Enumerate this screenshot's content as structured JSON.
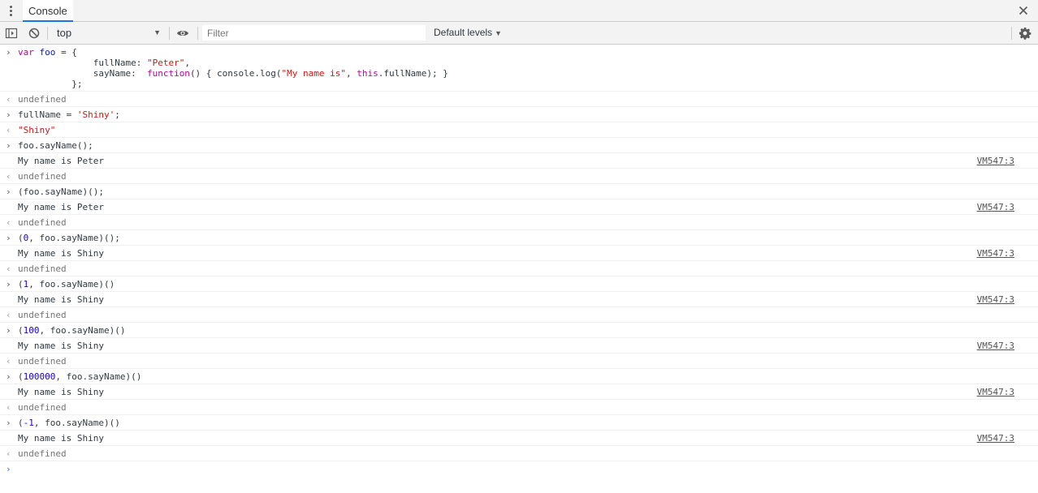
{
  "tabbar": {
    "tab_label": "Console"
  },
  "toolbar": {
    "context_value": "top",
    "filter_placeholder": "Filter",
    "levels_label": "Default levels"
  },
  "console": {
    "messages": [
      {
        "type": "input",
        "code": [
          {
            "t": "var ",
            "c": "kw"
          },
          {
            "t": "foo",
            "c": "var"
          },
          {
            "t": " = {\n              fullName: "
          },
          {
            "t": "\"Peter\"",
            "c": "str"
          },
          {
            "t": ",\n              sayName:  "
          },
          {
            "t": "function",
            "c": "kw"
          },
          {
            "t": "() { console.log("
          },
          {
            "t": "\"My name is\"",
            "c": "str"
          },
          {
            "t": ", "
          },
          {
            "t": "this",
            "c": "kw"
          },
          {
            "t": ".fullName); }\n          };"
          }
        ]
      },
      {
        "type": "result",
        "code": [
          {
            "t": "undefined"
          }
        ]
      },
      {
        "type": "input",
        "code": [
          {
            "t": "fullName = "
          },
          {
            "t": "'Shiny'",
            "c": "str"
          },
          {
            "t": ";"
          }
        ]
      },
      {
        "type": "result",
        "code": [
          {
            "t": "\"Shiny\"",
            "c": "str"
          }
        ]
      },
      {
        "type": "input",
        "code": [
          {
            "t": "foo.sayName();"
          }
        ]
      },
      {
        "type": "log",
        "code": [
          {
            "t": "My name is Peter"
          }
        ],
        "source": "VM547:3"
      },
      {
        "type": "result",
        "code": [
          {
            "t": "undefined"
          }
        ]
      },
      {
        "type": "input",
        "code": [
          {
            "t": "(foo.sayName)();"
          }
        ]
      },
      {
        "type": "log",
        "code": [
          {
            "t": "My name is Peter"
          }
        ],
        "source": "VM547:3"
      },
      {
        "type": "result",
        "code": [
          {
            "t": "undefined"
          }
        ]
      },
      {
        "type": "input",
        "code": [
          {
            "t": "("
          },
          {
            "t": "0",
            "c": "num"
          },
          {
            "t": ", foo.sayName)();"
          }
        ]
      },
      {
        "type": "log",
        "code": [
          {
            "t": "My name is Shiny"
          }
        ],
        "source": "VM547:3"
      },
      {
        "type": "result",
        "code": [
          {
            "t": "undefined"
          }
        ]
      },
      {
        "type": "input",
        "code": [
          {
            "t": "("
          },
          {
            "t": "1",
            "c": "num"
          },
          {
            "t": ", foo.sayName)()"
          }
        ]
      },
      {
        "type": "log",
        "code": [
          {
            "t": "My name is Shiny"
          }
        ],
        "source": "VM547:3"
      },
      {
        "type": "result",
        "code": [
          {
            "t": "undefined"
          }
        ]
      },
      {
        "type": "input",
        "code": [
          {
            "t": "("
          },
          {
            "t": "100",
            "c": "num"
          },
          {
            "t": ", foo.sayName)()"
          }
        ]
      },
      {
        "type": "log",
        "code": [
          {
            "t": "My name is Shiny"
          }
        ],
        "source": "VM547:3"
      },
      {
        "type": "result",
        "code": [
          {
            "t": "undefined"
          }
        ]
      },
      {
        "type": "input",
        "code": [
          {
            "t": "("
          },
          {
            "t": "100000",
            "c": "num"
          },
          {
            "t": ", foo.sayName)()"
          }
        ]
      },
      {
        "type": "log",
        "code": [
          {
            "t": "My name is Shiny"
          }
        ],
        "source": "VM547:3"
      },
      {
        "type": "result",
        "code": [
          {
            "t": "undefined"
          }
        ]
      },
      {
        "type": "input",
        "code": [
          {
            "t": "("
          },
          {
            "t": "-1",
            "c": "num"
          },
          {
            "t": ", foo.sayName)()"
          }
        ]
      },
      {
        "type": "log",
        "code": [
          {
            "t": "My name is Shiny"
          }
        ],
        "source": "VM547:3"
      },
      {
        "type": "result",
        "code": [
          {
            "t": "undefined"
          }
        ]
      }
    ]
  }
}
